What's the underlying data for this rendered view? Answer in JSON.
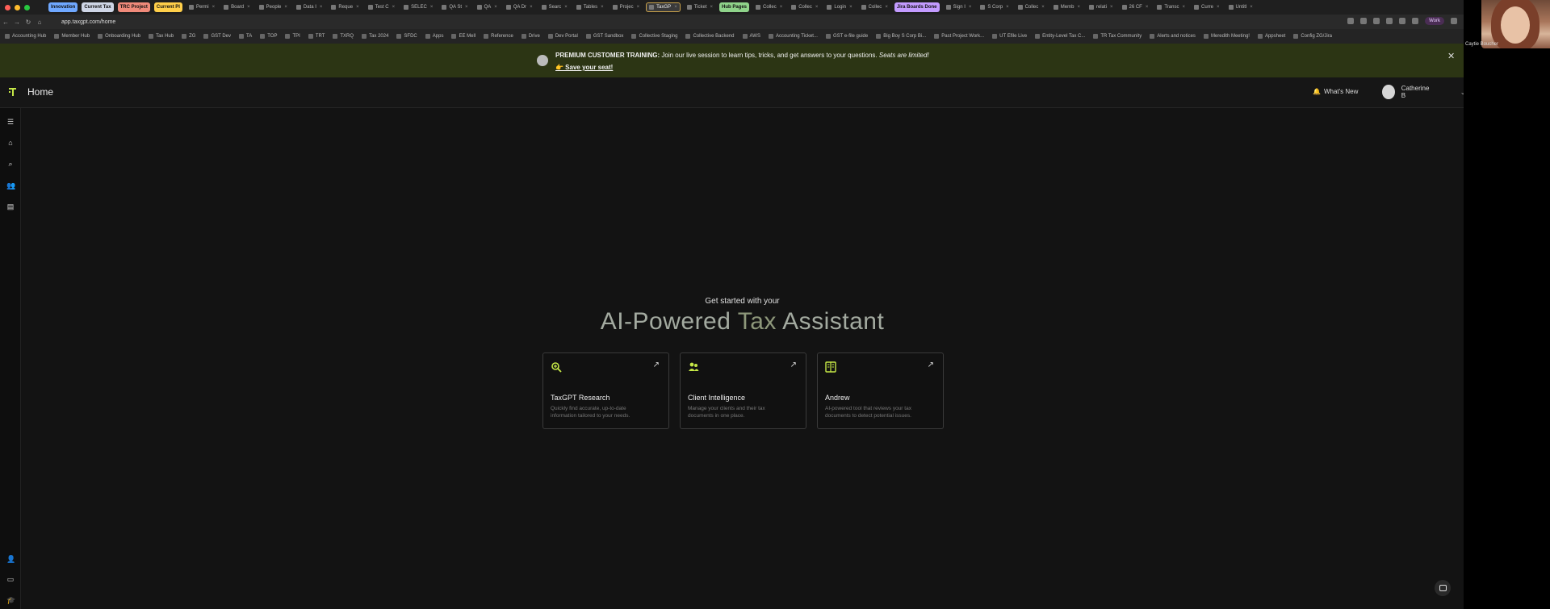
{
  "browser": {
    "tabs": [
      {
        "label": "Innovation",
        "group": true,
        "color": "#6fa8ff"
      },
      {
        "label": "Current Tax",
        "group": true,
        "color": "#cfd6e6"
      },
      {
        "label": "TRC Project",
        "group": true,
        "color": "#f08a7a"
      },
      {
        "label": "Current Pl",
        "group": true,
        "color": "#ffcf4a"
      },
      {
        "label": "Permi"
      },
      {
        "label": "Board"
      },
      {
        "label": "People"
      },
      {
        "label": "Data I"
      },
      {
        "label": "Reque"
      },
      {
        "label": "Test C"
      },
      {
        "label": "SELEC"
      },
      {
        "label": "QA St"
      },
      {
        "label": "QA"
      },
      {
        "label": "QA Dr"
      },
      {
        "label": "Searc"
      },
      {
        "label": "Tables"
      },
      {
        "label": "Projec"
      },
      {
        "label": "TaxGP",
        "active": true
      },
      {
        "label": "Ticket"
      },
      {
        "label": "Hub Pages",
        "group": true,
        "color": "#8fd38a"
      },
      {
        "label": "Collec"
      },
      {
        "label": "Collec"
      },
      {
        "label": "Login"
      },
      {
        "label": "Collec"
      },
      {
        "label": "Jira Boards Done",
        "group": true,
        "color": "#c39bff"
      },
      {
        "label": "Sign I"
      },
      {
        "label": "S Corp"
      },
      {
        "label": "Collec"
      },
      {
        "label": "Memb"
      },
      {
        "label": "relati"
      },
      {
        "label": "26 CF"
      },
      {
        "label": "Transc"
      },
      {
        "label": "Curre"
      },
      {
        "label": "Untitl"
      }
    ],
    "url": "app.taxgpt.com/home",
    "work_badge": "Work",
    "bookmarks": [
      "Accounting Hub",
      "Member Hub",
      "Onboarding Hub",
      "Tax Hub",
      "ZG",
      "GST Dev",
      "TA",
      "TOP",
      "TPI",
      "TRT",
      "TXRQ",
      "Tax 2024",
      "SFDC",
      "Apps",
      "EE Mell",
      "Reference",
      "Drive",
      "Dev Portal",
      "GST Sandbox",
      "Collective Staging",
      "Collective Backend",
      "AWS",
      "Accounting Ticket...",
      "GST e-file guide",
      "Big Boy S Corp Bi...",
      "Past Project Work...",
      "UT Efile Live",
      "Entity-Level Tax C...",
      "TR Tax Community",
      "Alerts and notices",
      "Meredith Meeting!",
      "Appsheet",
      "Config ZG/Jira"
    ]
  },
  "banner": {
    "lead": "PREMIUM CUSTOMER TRAINING:",
    "text": " Join our live session to learn tips, tricks, and get answers to your questions. ",
    "emphasis": "Seats are limited!",
    "cta": "👉 Save your seat!",
    "close": "✕"
  },
  "header": {
    "title": "Home",
    "whats_new": "What's New",
    "user_name": "Catherine B"
  },
  "hero": {
    "subtitle": "Get started with your",
    "headline_main": "AI-Powered ",
    "headline_accent": "Tax ",
    "headline_end": "Assistant"
  },
  "cards": [
    {
      "title": "TaxGPT Research",
      "description": "Quickly find accurate, up-to-date information tailored to your needs.",
      "icon": "search-zoom-icon"
    },
    {
      "title": "Client Intelligence",
      "description": "Manage your clients and their tax documents in one place.",
      "icon": "people-icon"
    },
    {
      "title": "Andrew",
      "description": "AI-powered tool that reviews your tax documents to detect potential issues.",
      "icon": "book-icon"
    }
  ],
  "video": {
    "participant": "Caytie Boucher"
  },
  "colors": {
    "accent": "#c6e847",
    "banner_bg": "#2c3514"
  }
}
